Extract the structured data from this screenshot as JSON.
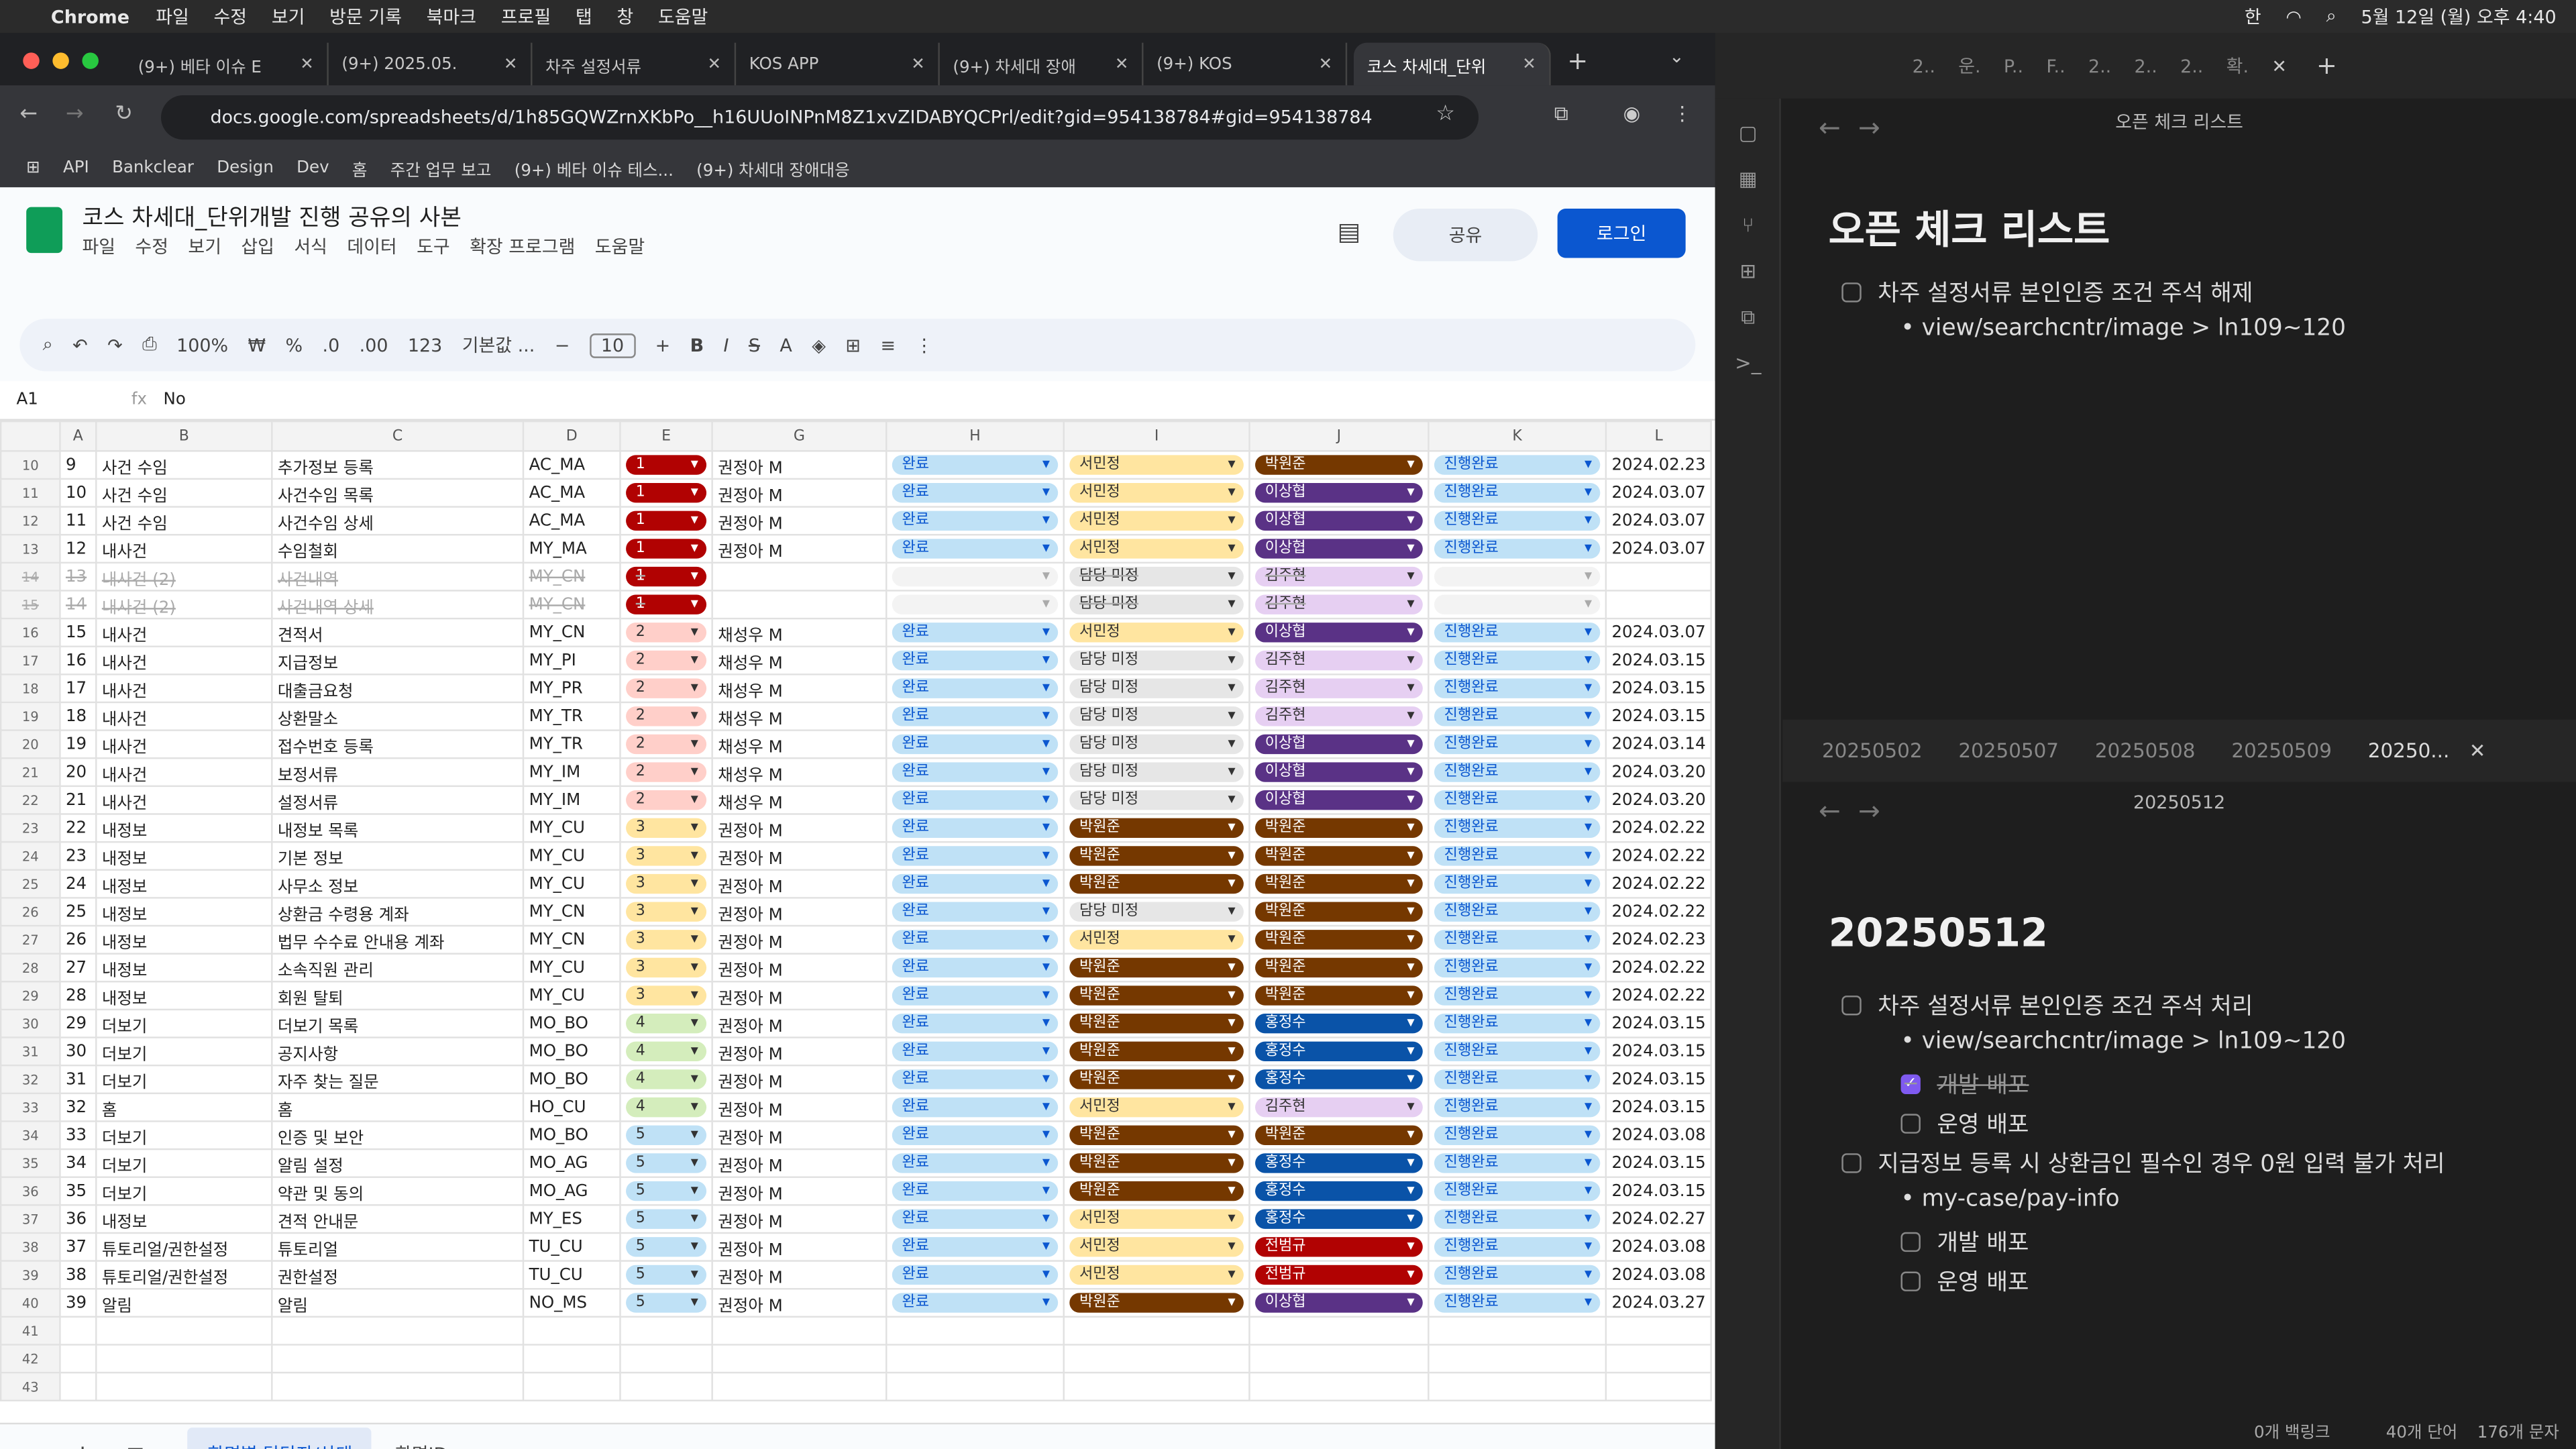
{
  "menubar": {
    "app": "Chrome",
    "items": [
      "파일",
      "수정",
      "보기",
      "방문 기록",
      "북마크",
      "프로필",
      "탭",
      "창",
      "도움말"
    ],
    "clock": "5월 12일 (월) 오후 4:40",
    "ime": "한"
  },
  "browser": {
    "tabs": [
      "(9+) 베타 이슈 E",
      "(9+) 2025.05.",
      "차주 설정서류",
      "KOS APP",
      "(9+) 차세대 장애",
      "(9+) KOS",
      "코스 차세대_단위"
    ],
    "url": "docs.google.com/spreadsheets/d/1h85GQWZrnXKbPo__h16UUoINPnM8Z1xvZIDABYQCPrl/edit?gid=954138784#gid=954138784",
    "bookmarks": [
      "API",
      "Bankclear",
      "Design",
      "Dev",
      "홈",
      "주간 업무 보고",
      "(9+) 베타 이슈 테스...",
      "(9+) 차세대 장애대응"
    ]
  },
  "sheet": {
    "title": "코스 차세대_단위개발 진행 공유의 사본",
    "menus": [
      "파일",
      "수정",
      "보기",
      "삽입",
      "서식",
      "데이터",
      "도구",
      "확장 프로그램",
      "도움말"
    ],
    "share": "공유",
    "login": "로그인",
    "toolbar": {
      "zoom": "100%",
      "currency": "₩",
      "percent": "%",
      "dec_minus": ".0",
      "dec_plus": ".00",
      "num": "123",
      "font": "기본값 ...",
      "size": "10"
    },
    "cell_ref": "A1",
    "formula": "No",
    "columns": [
      "A",
      "B",
      "C",
      "D",
      "E",
      "G",
      "H",
      "I",
      "J",
      "K",
      "L"
    ],
    "rows": [
      [
        "10",
        "9",
        "사건 수임",
        "추가정보 등록",
        "AC_MA",
        "1",
        "권정아 M",
        "완료",
        "서민정",
        "박원준",
        "진행완료",
        "2024.02.23"
      ],
      [
        "11",
        "10",
        "사건 수임",
        "사건수임 목록",
        "AC_MA",
        "1",
        "권정아 M",
        "완료",
        "서민정",
        "이상협",
        "진행완료",
        "2024.03.07"
      ],
      [
        "12",
        "11",
        "사건 수임",
        "사건수임 상세",
        "AC_MA",
        "1",
        "권정아 M",
        "완료",
        "서민정",
        "이상협",
        "진행완료",
        "2024.03.07"
      ],
      [
        "13",
        "12",
        "내사건",
        "수임철회",
        "MY_MA",
        "1",
        "권정아 M",
        "완료",
        "서민정",
        "이상협",
        "진행완료",
        "2024.03.07"
      ],
      [
        "14",
        "13",
        "내사건 (2)",
        "사건내역",
        "MY_CN",
        "1",
        "",
        "",
        "담당 미정",
        "김주현",
        "",
        ""
      ],
      [
        "15",
        "14",
        "내사건 (2)",
        "사건내역 상세",
        "MY_CN",
        "1",
        "",
        "",
        "담당 미정",
        "김주현",
        "",
        ""
      ],
      [
        "16",
        "15",
        "내사건",
        "견적서",
        "MY_CN",
        "2",
        "채성우 M",
        "완료",
        "서민정",
        "이상협",
        "진행완료",
        "2024.03.07"
      ],
      [
        "17",
        "16",
        "내사건",
        "지급정보",
        "MY_PI",
        "2",
        "채성우 M",
        "완료",
        "담당 미정",
        "김주현",
        "진행완료",
        "2024.03.15"
      ],
      [
        "18",
        "17",
        "내사건",
        "대출금요청",
        "MY_PR",
        "2",
        "채성우 M",
        "완료",
        "담당 미정",
        "김주현",
        "진행완료",
        "2024.03.15"
      ],
      [
        "19",
        "18",
        "내사건",
        "상환말소",
        "MY_TR",
        "2",
        "채성우 M",
        "완료",
        "담당 미정",
        "김주현",
        "진행완료",
        "2024.03.15"
      ],
      [
        "20",
        "19",
        "내사건",
        "접수번호 등록",
        "MY_TR",
        "2",
        "채성우 M",
        "완료",
        "담당 미정",
        "이상협",
        "진행완료",
        "2024.03.14"
      ],
      [
        "21",
        "20",
        "내사건",
        "보정서류",
        "MY_IM",
        "2",
        "채성우 M",
        "완료",
        "담당 미정",
        "이상협",
        "진행완료",
        "2024.03.20"
      ],
      [
        "22",
        "21",
        "내사건",
        "설정서류",
        "MY_IM",
        "2",
        "채성우 M",
        "완료",
        "담당 미정",
        "이상협",
        "진행완료",
        "2024.03.20"
      ],
      [
        "23",
        "22",
        "내정보",
        "내정보 목록",
        "MY_CU",
        "3",
        "권정아 M",
        "완료",
        "박원준",
        "박원준",
        "진행완료",
        "2024.02.22"
      ],
      [
        "24",
        "23",
        "내정보",
        "기본 정보",
        "MY_CU",
        "3",
        "권정아 M",
        "완료",
        "박원준",
        "박원준",
        "진행완료",
        "2024.02.22"
      ],
      [
        "25",
        "24",
        "내정보",
        "사무소 정보",
        "MY_CU",
        "3",
        "권정아 M",
        "완료",
        "박원준",
        "박원준",
        "진행완료",
        "2024.02.22"
      ],
      [
        "26",
        "25",
        "내정보",
        "상환금 수령용 계좌",
        "MY_CN",
        "3",
        "권정아 M",
        "완료",
        "담당 미정",
        "박원준",
        "진행완료",
        "2024.02.22"
      ],
      [
        "27",
        "26",
        "내정보",
        "법무 수수료 안내용 계좌",
        "MY_CN",
        "3",
        "권정아 M",
        "완료",
        "서민정",
        "박원준",
        "진행완료",
        "2024.02.23"
      ],
      [
        "28",
        "27",
        "내정보",
        "소속직원 관리",
        "MY_CU",
        "3",
        "권정아 M",
        "완료",
        "박원준",
        "박원준",
        "진행완료",
        "2024.02.22"
      ],
      [
        "29",
        "28",
        "내정보",
        "회원 탈퇴",
        "MY_CU",
        "3",
        "권정아 M",
        "완료",
        "박원준",
        "박원준",
        "진행완료",
        "2024.02.22"
      ],
      [
        "30",
        "29",
        "더보기",
        "더보기 목록",
        "MO_BO",
        "4",
        "권정아 M",
        "완료",
        "박원준",
        "홍정수",
        "진행완료",
        "2024.03.15"
      ],
      [
        "31",
        "30",
        "더보기",
        "공지사항",
        "MO_BO",
        "4",
        "권정아 M",
        "완료",
        "박원준",
        "홍정수",
        "진행완료",
        "2024.03.15"
      ],
      [
        "32",
        "31",
        "더보기",
        "자주 찾는 질문",
        "MO_BO",
        "4",
        "권정아 M",
        "완료",
        "박원준",
        "홍정수",
        "진행완료",
        "2024.03.15"
      ],
      [
        "33",
        "32",
        "홈",
        "홈",
        "HO_CU",
        "4",
        "권정아 M",
        "완료",
        "서민정",
        "김주현",
        "진행완료",
        "2024.03.15"
      ],
      [
        "34",
        "33",
        "더보기",
        "인증 및 보안",
        "MO_BO",
        "5",
        "권정아 M",
        "완료",
        "박원준",
        "박원준",
        "진행완료",
        "2024.03.08"
      ],
      [
        "35",
        "34",
        "더보기",
        "알림 설정",
        "MO_AG",
        "5",
        "권정아 M",
        "완료",
        "박원준",
        "홍정수",
        "진행완료",
        "2024.03.15"
      ],
      [
        "36",
        "35",
        "더보기",
        "약관 및 동의",
        "MO_AG",
        "5",
        "권정아 M",
        "완료",
        "박원준",
        "홍정수",
        "진행완료",
        "2024.03.15"
      ],
      [
        "37",
        "36",
        "내정보",
        "견적 안내문",
        "MY_ES",
        "5",
        "권정아 M",
        "완료",
        "서민정",
        "홍정수",
        "진행완료",
        "2024.02.27"
      ],
      [
        "38",
        "37",
        "튜토리얼/권한설정",
        "튜토리얼",
        "TU_CU",
        "5",
        "권정아 M",
        "완료",
        "서민정",
        "전범규",
        "진행완료",
        "2024.03.08"
      ],
      [
        "39",
        "38",
        "튜토리얼/권한설정",
        "권한설정",
        "TU_CU",
        "5",
        "권정아 M",
        "완료",
        "서민정",
        "전범규",
        "진행완료",
        "2024.03.08"
      ],
      [
        "40",
        "39",
        "알림",
        "알림",
        "NO_MS",
        "5",
        "권정아 M",
        "완료",
        "박원준",
        "이상협",
        "진행완료",
        "2024.03.27"
      ]
    ],
    "empty_rows": [
      "41",
      "42",
      "43"
    ],
    "tabs": [
      "화면별 담당자/상태",
      "화면ID"
    ]
  },
  "colors": {
    "stage1": "#b10202",
    "stage2": "#ffcfc9",
    "stage3": "#ffe5a0",
    "stage4": "#d4edbc",
    "stage5": "#bfe1f6",
    "done": "#bfe1f6",
    "서민정": "#ffe5a0",
    "박원준": "#753800",
    "담당 미정": "#e6e6e6",
    "이상협": "#5a3286",
    "김주현": "#e6cff2",
    "홍정수": "#0a53a8",
    "전범규": "#b10202"
  },
  "obsidian": {
    "tabs": [
      "2..",
      "운.",
      "P..",
      "F..",
      "2..",
      "2..",
      "2..",
      "확."
    ],
    "top_title": "오픈 체크 리스트",
    "top_heading": "오픈 체크 리스트",
    "top_item": "차주 설정서류 본인인증 조건 주석 해제",
    "top_sub": "view/searchcntr/image > ln109~120",
    "date_tabs": [
      "20250502",
      "20250507",
      "20250508",
      "20250509",
      "20250..."
    ],
    "bottom_title": "20250512",
    "bottom_heading": "20250512",
    "task1": "차주 설정서류 본인인증 조건 주석 처리",
    "task1_sub": "view/searchcntr/image > ln109~120",
    "dev_deploy": "개발 배포",
    "ops_deploy": "운영 배포",
    "task2": "지급정보 등록 시 상환금인 필수인 경우 0원 입력 불가 처리",
    "task2_sub": "my-case/pay-info",
    "status": {
      "backlinks": "0개 백링크",
      "words": "40개 단어",
      "chars": "176개 문자"
    }
  }
}
